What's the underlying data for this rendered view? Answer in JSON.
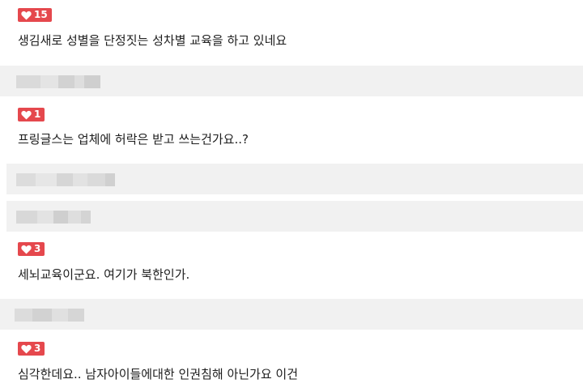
{
  "colors": {
    "badge_bg": "#e5484d",
    "author_bar_bg": "#f1f1f1",
    "text": "#1d1d1d"
  },
  "comments": [
    {
      "likes": "15",
      "text": "생김새로 성별을 단정짓는 성차별 교육을 하고 있네요",
      "icon": "heart-icon"
    },
    {
      "likes": "1",
      "text": "프링글스는 업체에 허락은 받고 쓰는건가요..?",
      "icon": "heart-icon"
    },
    {
      "likes": "3",
      "text": "세뇌교육이군요. 여기가 북한인가.",
      "icon": "heart-icon"
    },
    {
      "likes": "3",
      "text": "심각한데요.. 남자아이들에대한 인권침해 아닌가요 이건",
      "icon": "heart-icon"
    }
  ]
}
